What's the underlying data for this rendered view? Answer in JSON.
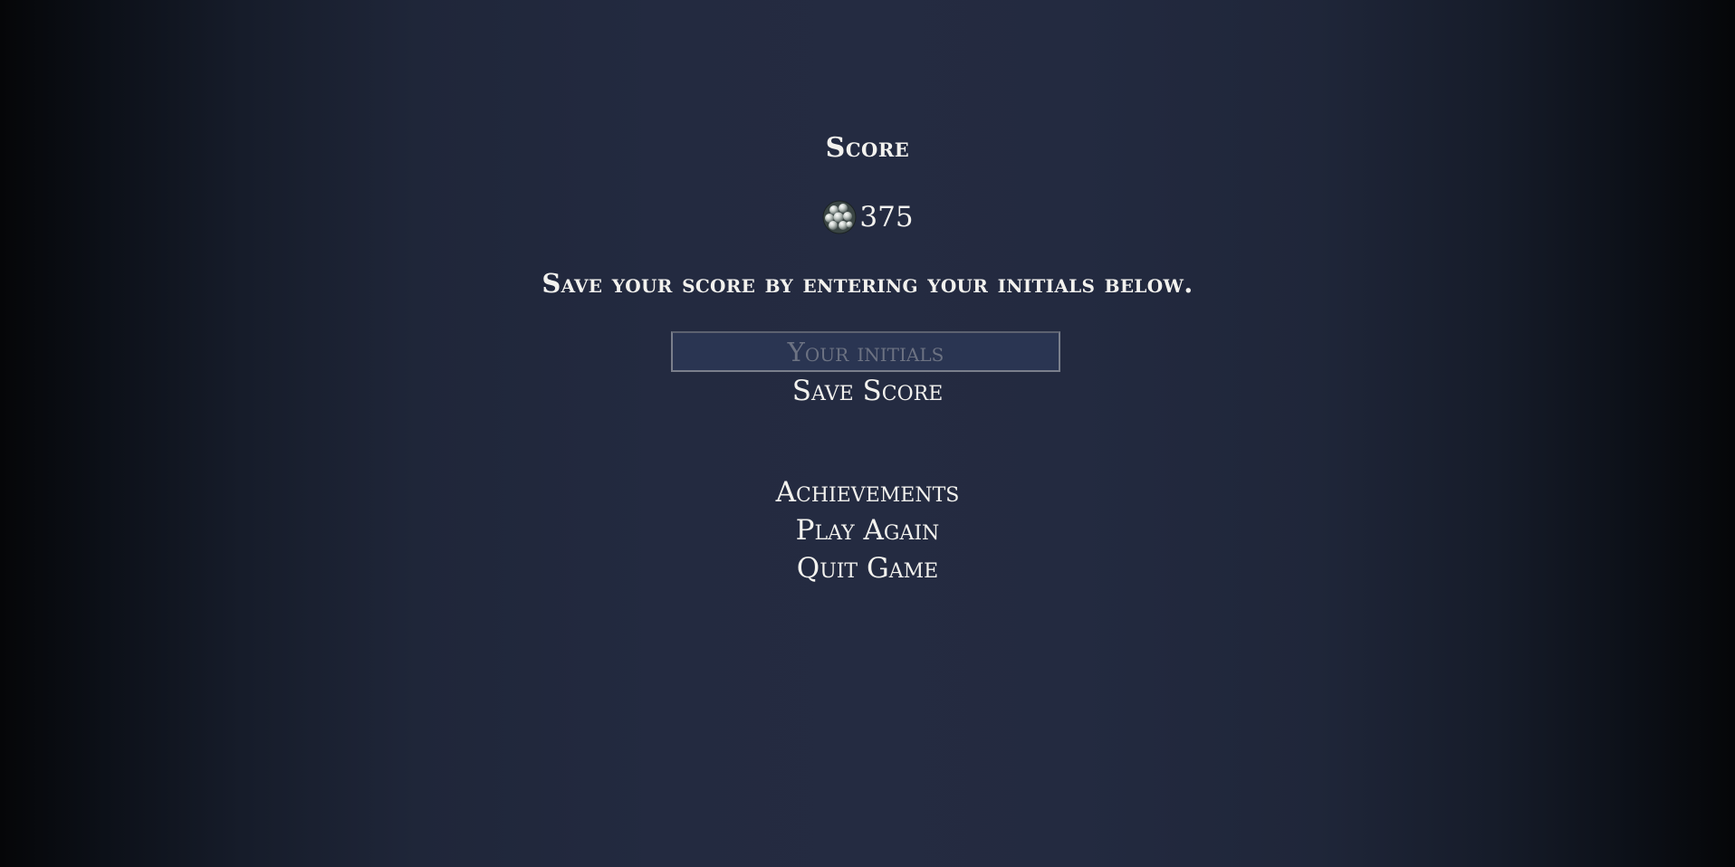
{
  "score_panel": {
    "heading": "Score",
    "currency_icon": "pearl-cluster-icon",
    "value": "375"
  },
  "save_section": {
    "prompt": "Save your score by entering your initials below.",
    "initials_placeholder": "Your initials",
    "initials_value": "",
    "save_label": "Save Score"
  },
  "menu": {
    "achievements_label": "Achievements",
    "play_again_label": "Play Again",
    "quit_label": "Quit Game"
  },
  "colors": {
    "background_center": "#242b41",
    "background_edge": "#050608",
    "text": "#f3f2ee",
    "input_background": "#2a3552",
    "placeholder": "#6c7282"
  }
}
